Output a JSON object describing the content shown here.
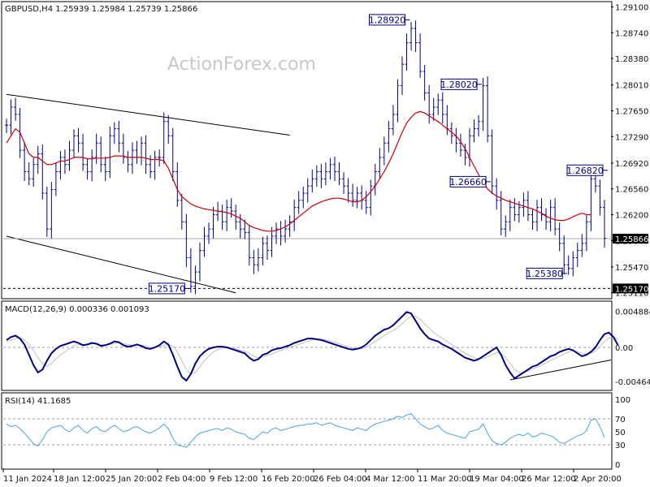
{
  "chart_data": {
    "type": "line",
    "instrument": "GBPUSD,H4",
    "ohlc_label": "GBPUSD,H4  1.25939 1.25984 1.25739 1.25866",
    "watermark": "ActionForex.com",
    "main_panel": {
      "price_ticks": [
        "1.29100",
        "1.28740",
        "1.28380",
        "1.28010",
        "1.27650",
        "1.27290",
        "1.26920",
        "1.26560",
        "1.26200",
        "1.25840",
        "1.25470",
        "1.25110"
      ],
      "ylim": [
        1.2505,
        1.2914
      ],
      "price_markers": [
        {
          "label": "1.28920",
          "price": 1.2892
        },
        {
          "label": "1.28020",
          "price": 1.2802
        },
        {
          "label": "1.26660",
          "price": 1.2666
        },
        {
          "label": "1.26820",
          "price": 1.2682
        },
        {
          "label": "1.25170",
          "price": 1.2517
        },
        {
          "label": "1.25380",
          "price": 1.2538
        }
      ],
      "current_price": "1.25866",
      "support_label": "1.25170",
      "close_series": [
        1.2745,
        1.277,
        1.276,
        1.271,
        1.268,
        1.267,
        1.269,
        1.2705,
        1.265,
        1.26,
        1.2655,
        1.268,
        1.27,
        1.269,
        1.271,
        1.273,
        1.272,
        1.269,
        1.268,
        1.27,
        1.272,
        1.269,
        1.268,
        1.273,
        1.274,
        1.272,
        1.27,
        1.269,
        1.271,
        1.27,
        1.272,
        1.269,
        1.268,
        1.27,
        1.27,
        1.275,
        1.273,
        1.268,
        1.264,
        1.261,
        1.256,
        1.252,
        1.254,
        1.257,
        1.259,
        1.26,
        1.262,
        1.2625,
        1.261,
        1.263,
        1.2625,
        1.261,
        1.26,
        1.2595,
        1.256,
        1.255,
        1.256,
        1.258,
        1.257,
        1.259,
        1.26,
        1.259,
        1.26,
        1.261,
        1.263,
        1.264,
        1.265,
        1.266,
        1.267,
        1.268,
        1.267,
        1.268,
        1.269,
        1.268,
        1.267,
        1.266,
        1.265,
        1.264,
        1.265,
        1.264,
        1.263,
        1.266,
        1.268,
        1.27,
        1.272,
        1.274,
        1.276,
        1.28,
        1.283,
        1.286,
        1.288,
        1.286,
        1.282,
        1.279,
        1.276,
        1.277,
        1.278,
        1.276,
        1.274,
        1.273,
        1.272,
        1.271,
        1.27,
        1.273,
        1.274,
        1.275,
        1.28,
        1.273,
        1.266,
        1.264,
        1.26,
        1.261,
        1.263,
        1.262,
        1.263,
        1.264,
        1.262,
        1.261,
        1.263,
        1.262,
        1.261,
        1.263,
        1.26,
        1.258,
        1.255,
        1.2545,
        1.256,
        1.257,
        1.258,
        1.261,
        1.267,
        1.266,
        1.263,
        1.2587
      ],
      "moving_average": [
        1.272,
        1.273,
        1.274,
        1.2735,
        1.272,
        1.2705,
        1.27,
        1.27,
        1.2695,
        1.269,
        1.269,
        1.2692,
        1.2695,
        1.2695,
        1.2697,
        1.27,
        1.27,
        1.27,
        1.2698,
        1.2698,
        1.2699,
        1.2699,
        1.2699,
        1.27,
        1.2702,
        1.2702,
        1.2702,
        1.27,
        1.27,
        1.27,
        1.27,
        1.2699,
        1.2697,
        1.2697,
        1.2697,
        1.2695,
        1.2685,
        1.267,
        1.2655,
        1.2645,
        1.264,
        1.2635,
        1.2632,
        1.263,
        1.2628,
        1.2627,
        1.2626,
        1.2625,
        1.2624,
        1.2623,
        1.2621,
        1.2618,
        1.2615,
        1.261,
        1.2605,
        1.2602,
        1.26,
        1.2598,
        1.2597,
        1.2597,
        1.2598,
        1.26,
        1.2603,
        1.2607,
        1.2612,
        1.2617,
        1.2622,
        1.2627,
        1.2632,
        1.2635,
        1.2638,
        1.264,
        1.2642,
        1.2643,
        1.2643,
        1.2642,
        1.264,
        1.2638,
        1.2638,
        1.264,
        1.2645,
        1.2652,
        1.266,
        1.267,
        1.268,
        1.2692,
        1.2705,
        1.272,
        1.2735,
        1.2748,
        1.2756,
        1.2762,
        1.2764,
        1.2762,
        1.2758,
        1.2754,
        1.275,
        1.2745,
        1.274,
        1.2735,
        1.273,
        1.2722,
        1.2712,
        1.27,
        1.2688,
        1.2676,
        1.2665,
        1.2656,
        1.265,
        1.2646,
        1.2643,
        1.264,
        1.2638,
        1.2636,
        1.2634,
        1.2632,
        1.263,
        1.2628,
        1.2625,
        1.2622,
        1.2618,
        1.2615,
        1.2613,
        1.2612,
        1.2612,
        1.2614,
        1.2617,
        1.262,
        1.2622,
        1.262,
        1.262
      ],
      "upper_channel": {
        "from": [
          0,
          1.2788
        ],
        "to": [
          63,
          1.2731
        ]
      },
      "lower_channel": {
        "from": [
          0,
          1.259
        ],
        "to": [
          51,
          1.2511
        ]
      }
    },
    "macd_panel": {
      "label": "MACD(12,26,9) 0.000336 0.001093",
      "ticks": [
        "0.004884",
        "0.00",
        "-0.004645"
      ],
      "ylim": [
        -0.0055,
        0.0055
      ],
      "macd": [
        0.001,
        0.0014,
        0.0016,
        0.0012,
        0.0004,
        -0.001,
        -0.0024,
        -0.0034,
        -0.003,
        -0.0018,
        -0.0008,
        -0.0002,
        0.0002,
        0.0004,
        0.0006,
        0.0008,
        0.0006,
        0.0003,
        0.0004,
        0.0006,
        0.0005,
        0.0002,
        0.0003,
        0.0005,
        0.0008,
        0.0007,
        0.0003,
        0.0001,
        0.0002,
        0.0004,
        0.0002,
        -0.0001,
        -0.0002,
        0.0,
        0.0003,
        0.0008,
        0.0004,
        -0.001,
        -0.0026,
        -0.004,
        -0.0045,
        -0.0036,
        -0.0022,
        -0.0012,
        -0.0006,
        -0.0002,
        0.0,
        0.0001,
        0.0001,
        0.0,
        -0.0002,
        -0.0004,
        -0.0006,
        -0.0008,
        -0.0014,
        -0.0018,
        -0.0016,
        -0.001,
        -0.0008,
        -0.0004,
        -0.0002,
        -0.0001,
        0.0001,
        0.0003,
        0.0006,
        0.0008,
        0.001,
        0.0012,
        0.0012,
        0.0011,
        0.001,
        0.0008,
        0.0006,
        0.0004,
        0.0002,
        0.0,
        -0.0002,
        -0.0003,
        -0.0002,
        0.0,
        0.0004,
        0.001,
        0.0016,
        0.002,
        0.0024,
        0.0026,
        0.003,
        0.0036,
        0.0042,
        0.0048,
        0.0046,
        0.0036,
        0.0026,
        0.0018,
        0.0012,
        0.001,
        0.0008,
        0.0004,
        0.0001,
        -0.0002,
        -0.0006,
        -0.001,
        -0.0014,
        -0.0016,
        -0.0018,
        -0.0016,
        -0.0012,
        -0.0008,
        -0.0004,
        0.0,
        -0.001,
        -0.0024,
        -0.0034,
        -0.0042,
        -0.0038,
        -0.0034,
        -0.003,
        -0.0026,
        -0.0024,
        -0.002,
        -0.0016,
        -0.0012,
        -0.001,
        -0.0006,
        -0.0004,
        -0.0002,
        -0.0004,
        -0.0008,
        -0.0012,
        -0.001,
        -0.0006,
        0.0,
        0.001,
        0.0018,
        0.002,
        0.0014,
        0.0003
      ],
      "signal": [
        0.0008,
        0.001,
        0.0012,
        0.0013,
        0.001,
        0.0004,
        -0.0004,
        -0.0014,
        -0.0022,
        -0.0026,
        -0.0022,
        -0.0016,
        -0.001,
        -0.0006,
        -0.0002,
        0.0002,
        0.0004,
        0.0004,
        0.0004,
        0.0005,
        0.0005,
        0.0004,
        0.0004,
        0.0004,
        0.0005,
        0.0006,
        0.0005,
        0.0004,
        0.0003,
        0.0003,
        0.0003,
        0.0002,
        0.0,
        0.0,
        0.0001,
        0.0003,
        0.0004,
        0.0002,
        -0.0006,
        -0.0018,
        -0.003,
        -0.0036,
        -0.0034,
        -0.0026,
        -0.0018,
        -0.0012,
        -0.0006,
        -0.0003,
        -0.0001,
        0.0,
        -0.0001,
        -0.0002,
        -0.0004,
        -0.0005,
        -0.0008,
        -0.0012,
        -0.0014,
        -0.0013,
        -0.0011,
        -0.0009,
        -0.0006,
        -0.0004,
        -0.0002,
        0.0,
        0.0002,
        0.0004,
        0.0006,
        0.0008,
        0.001,
        0.0011,
        0.0011,
        0.001,
        0.0009,
        0.0007,
        0.0005,
        0.0003,
        0.0001,
        -0.0001,
        -0.0002,
        -0.0002,
        0.0,
        0.0004,
        0.0008,
        0.0012,
        0.0016,
        0.002,
        0.0023,
        0.0027,
        0.0032,
        0.0038,
        0.0042,
        0.0042,
        0.0038,
        0.0032,
        0.0026,
        0.002,
        0.0016,
        0.0012,
        0.0008,
        0.0004,
        0.0,
        -0.0004,
        -0.0008,
        -0.0011,
        -0.0014,
        -0.0015,
        -0.0015,
        -0.0013,
        -0.001,
        -0.0007,
        -0.0008,
        -0.0014,
        -0.0022,
        -0.003,
        -0.0034,
        -0.0034,
        -0.0032,
        -0.0029,
        -0.0027,
        -0.0024,
        -0.0021,
        -0.0018,
        -0.0015,
        -0.0012,
        -0.0009,
        -0.0006,
        -0.0005,
        -0.0006,
        -0.0008,
        -0.0009,
        -0.0008,
        -0.0005,
        0.0001,
        0.0008,
        0.0013,
        0.0014,
        0.0011
      ],
      "trendline": {
        "from": [
          112,
          -0.0044
        ],
        "to": [
          137,
          -0.0017
        ]
      }
    },
    "rsi_panel": {
      "label": "RSI(14) 41.1685",
      "ticks": [
        "100",
        "70",
        "50",
        "30",
        "0"
      ],
      "levels": [
        70,
        30
      ],
      "ylim": [
        0,
        100
      ],
      "rsi": [
        62,
        58,
        60,
        55,
        48,
        40,
        32,
        28,
        38,
        50,
        56,
        58,
        60,
        54,
        50,
        56,
        60,
        52,
        48,
        55,
        58,
        52,
        50,
        56,
        60,
        55,
        50,
        52,
        56,
        58,
        54,
        50,
        48,
        52,
        56,
        62,
        55,
        40,
        30,
        28,
        26,
        34,
        42,
        48,
        50,
        52,
        54,
        55,
        52,
        56,
        54,
        50,
        48,
        46,
        40,
        38,
        44,
        50,
        48,
        54,
        56,
        52,
        54,
        56,
        58,
        60,
        60,
        62,
        62,
        64,
        60,
        62,
        64,
        60,
        58,
        56,
        54,
        52,
        56,
        54,
        52,
        58,
        62,
        64,
        66,
        68,
        70,
        74,
        72,
        76,
        78,
        70,
        62,
        58,
        54,
        56,
        60,
        52,
        48,
        46,
        44,
        42,
        40,
        50,
        52,
        54,
        62,
        48,
        36,
        32,
        30,
        34,
        40,
        44,
        46,
        44,
        48,
        42,
        44,
        48,
        46,
        44,
        40,
        34,
        32,
        36,
        40,
        44,
        46,
        52,
        68,
        70,
        58,
        41
      ]
    },
    "x_ticks": [
      "11 Jan 2024",
      "18 Jan 12:00",
      "25 Jan 20:00",
      "2 Feb 04:00",
      "9 Feb 12:00",
      "16 Feb 20:00",
      "26 Feb 04:00",
      "4 Mar 12:00",
      "11 Mar 20:00",
      "19 Mar 04:00",
      "26 Mar 12:00",
      "2 Apr 20:00"
    ],
    "colors": {
      "price": "#000080",
      "moving_average": "#cc0000",
      "macd": "#000080",
      "signal": "#c0c0c0",
      "rsi": "#4aa3df",
      "trendline": "#000000"
    }
  }
}
